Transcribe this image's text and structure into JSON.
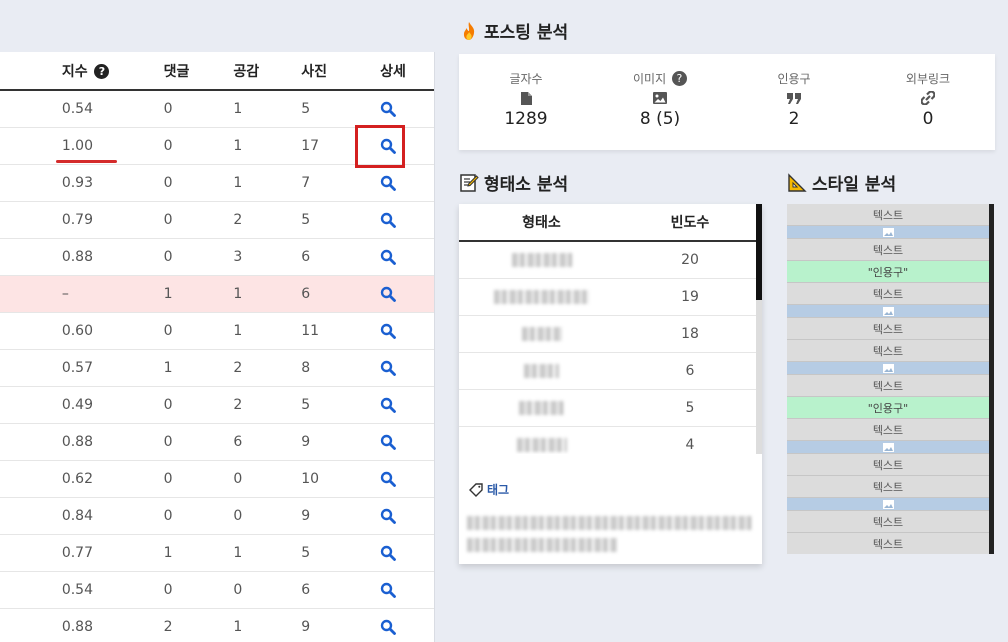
{
  "left_table": {
    "headers": [
      "",
      "지수",
      "댓글",
      "공감",
      "사진",
      "상세"
    ],
    "rows": [
      {
        "index": "0.54",
        "comments": "0",
        "likes": "1",
        "photos": "5"
      },
      {
        "index": "1.00",
        "comments": "0",
        "likes": "1",
        "photos": "17"
      },
      {
        "index": "0.93",
        "comments": "0",
        "likes": "1",
        "photos": "7"
      },
      {
        "index": "0.79",
        "comments": "0",
        "likes": "2",
        "photos": "5"
      },
      {
        "index": "0.88",
        "comments": "0",
        "likes": "3",
        "photos": "6"
      },
      {
        "index": "–",
        "comments": "1",
        "likes": "1",
        "photos": "6"
      },
      {
        "index": "0.60",
        "comments": "0",
        "likes": "1",
        "photos": "11"
      },
      {
        "index": "0.57",
        "comments": "1",
        "likes": "2",
        "photos": "8"
      },
      {
        "index": "0.49",
        "comments": "0",
        "likes": "2",
        "photos": "5"
      },
      {
        "index": "0.88",
        "comments": "0",
        "likes": "6",
        "photos": "9"
      },
      {
        "index": "0.62",
        "comments": "0",
        "likes": "0",
        "photos": "10"
      },
      {
        "index": "0.84",
        "comments": "0",
        "likes": "0",
        "photos": "9"
      },
      {
        "index": "0.77",
        "comments": "1",
        "likes": "1",
        "photos": "5"
      },
      {
        "index": "0.54",
        "comments": "0",
        "likes": "0",
        "photos": "6"
      },
      {
        "index": "0.88",
        "comments": "2",
        "likes": "1",
        "photos": "9"
      }
    ],
    "highlighted_row": 5,
    "help_badge": "?",
    "accent_color": "#1a5fd1",
    "highlight_color": "#fde4e4",
    "annotation_color": "#d42020"
  },
  "posting": {
    "title": "포스팅 분석",
    "stats": [
      {
        "label": "글자수",
        "icon": "document-icon",
        "value": "1289"
      },
      {
        "label": "이미지",
        "icon": "image-icon",
        "value": "8 (5)",
        "help": "?"
      },
      {
        "label": "인용구",
        "icon": "quote-icon",
        "value": "2"
      },
      {
        "label": "외부링크",
        "icon": "link-icon",
        "value": "0"
      }
    ]
  },
  "morph": {
    "title": "형태소 분석",
    "headers": [
      "형태소",
      "빈도수"
    ],
    "counts": [
      "20",
      "19",
      "18",
      "6",
      "5",
      "4"
    ]
  },
  "tags": {
    "title": "태그"
  },
  "style": {
    "title": "스타일 분석",
    "text_label": "텍스트",
    "quote_label": "\"인용구\"",
    "sequence": [
      "text",
      "img",
      "text",
      "quote",
      "text",
      "img",
      "text",
      "text",
      "img",
      "text",
      "quote",
      "text",
      "img",
      "text",
      "text",
      "img",
      "text",
      "text"
    ]
  }
}
